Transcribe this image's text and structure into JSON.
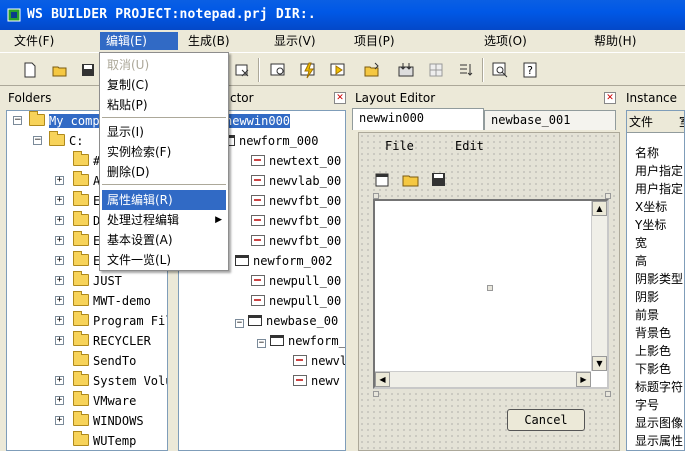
{
  "window": {
    "title": "WS BUILDER PROJECT:notepad.prj DIR:."
  },
  "menubar": [
    "文件(F)",
    "编辑(E)",
    "生成(B)",
    "显示(V)",
    "项目(P)",
    "选项(O)",
    "帮助(H)"
  ],
  "edit_menu": {
    "items": [
      {
        "label": "取消(U)",
        "disabled": true
      },
      {
        "label": "复制(C)"
      },
      {
        "label": "粘贴(P)"
      },
      {
        "label": "显示(I)"
      },
      {
        "label": "实例检索(F)"
      },
      {
        "label": "删除(D)"
      },
      {
        "label": "属性编辑(R)",
        "highlighted": true
      },
      {
        "label": "处理过程编辑",
        "submenu": true
      },
      {
        "label": "基本设置(A)"
      },
      {
        "label": "文件一览(L)"
      }
    ]
  },
  "folders_panel": {
    "title": "Folders",
    "root": "My comp",
    "drive": "C:",
    "items": [
      "#",
      "A",
      "E",
      "D",
      "E",
      "E",
      "JUST",
      "MWT-demo",
      "Program Fil",
      "RECYCLER",
      "SendTo",
      "System Volu",
      "VMware",
      "WINDOWS",
      "WUTemp"
    ]
  },
  "inspector_panel": {
    "title": "ctor",
    "tree": [
      "newwin000",
      "newform_000",
      "newtext_00",
      "newvlab_00",
      "newvfbt_00",
      "newvfbt_00",
      "newvfbt_00",
      "newform_002",
      "newpull_00",
      "newpull_00",
      "newbase_00",
      "newform_",
      "newvl",
      "newv"
    ]
  },
  "layout_panel": {
    "title": "Layout Editor",
    "tabs": [
      "newwin000",
      "newbase_001"
    ],
    "design_menu": [
      "File",
      "Edit"
    ],
    "cancel_label": "Cancel"
  },
  "instance_panel": {
    "title": "Instance",
    "tab": "文件",
    "tab2": "室",
    "properties": [
      "名称",
      "用户指定",
      "用户指定",
      "X坐标",
      "Y坐标",
      "宽",
      "高",
      "阴影类型",
      "阴影",
      "前景",
      "背景色",
      "上影色",
      "下影色",
      "标题字符",
      "字号",
      "显示图像",
      "显示属性"
    ]
  },
  "colors": {
    "title_bar": "#0058e6",
    "selection": "#316ac5",
    "chrome": "#ece9d8"
  }
}
